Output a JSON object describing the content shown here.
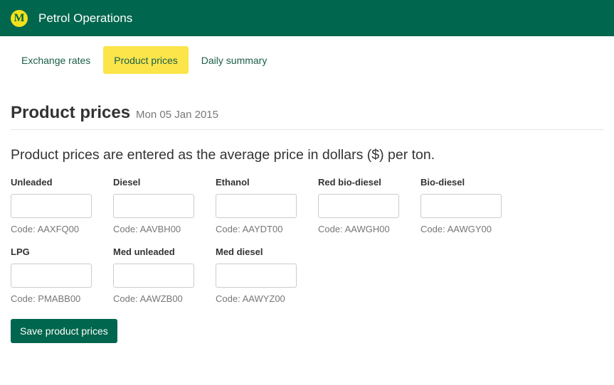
{
  "app": {
    "title": "Petrol Operations",
    "logo_letter": "M"
  },
  "tabs": [
    {
      "label": "Exchange rates",
      "active": false
    },
    {
      "label": "Product prices",
      "active": true
    },
    {
      "label": "Daily summary",
      "active": false
    }
  ],
  "page": {
    "title": "Product prices",
    "date": "Mon 05 Jan 2015",
    "intro": "Product prices are entered as the average price in dollars ($) per ton."
  },
  "fields": [
    {
      "label": "Unleaded",
      "code": "Code: AAXFQ00",
      "value": ""
    },
    {
      "label": "Diesel",
      "code": "Code: AAVBH00",
      "value": ""
    },
    {
      "label": "Ethanol",
      "code": "Code: AAYDT00",
      "value": ""
    },
    {
      "label": "Red bio-diesel",
      "code": "Code: AAWGH00",
      "value": ""
    },
    {
      "label": "Bio-diesel",
      "code": "Code: AAWGY00",
      "value": ""
    },
    {
      "label": "LPG",
      "code": "Code: PMABB00",
      "value": ""
    },
    {
      "label": "Med unleaded",
      "code": "Code: AAWZB00",
      "value": ""
    },
    {
      "label": "Med diesel",
      "code": "Code: AAWYZ00",
      "value": ""
    }
  ],
  "actions": {
    "save_label": "Save product prices"
  },
  "colors": {
    "brand": "#00664d",
    "accent": "#fbe54a",
    "logo": "#f5e11b"
  }
}
